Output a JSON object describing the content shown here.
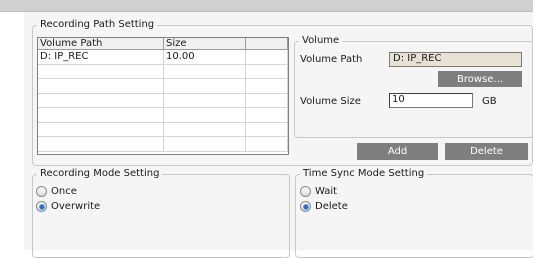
{
  "recording_path": {
    "legend": "Recording Path Setting",
    "columns": [
      "Volume Path",
      "Size",
      ""
    ],
    "rows": [
      [
        "D:  IP_REC",
        "10.00",
        ""
      ],
      [
        "",
        "",
        ""
      ],
      [
        "",
        "",
        ""
      ],
      [
        "",
        "",
        ""
      ],
      [
        "",
        "",
        ""
      ],
      [
        "",
        "",
        ""
      ],
      [
        "",
        "",
        ""
      ]
    ]
  },
  "volume": {
    "legend": "Volume",
    "path_label": "Volume Path",
    "path_value": "D:  IP_REC",
    "browse_label": "Browse...",
    "size_label": "Volume Size",
    "size_value": "10",
    "size_unit": "GB"
  },
  "actions": {
    "add_label": "Add",
    "delete_label": "Delete"
  },
  "recording_mode": {
    "legend": "Recording Mode Setting",
    "options": [
      {
        "label": "Once",
        "selected": false
      },
      {
        "label": "Overwrite",
        "selected": true
      }
    ]
  },
  "time_sync": {
    "legend": "Time Sync Mode Setting",
    "options": [
      {
        "label": "Wait",
        "selected": false
      },
      {
        "label": "Delete",
        "selected": true
      }
    ]
  },
  "colors": {
    "button_bg": "#7f7f7f",
    "readonly_bg": "#e6e3d5",
    "radio_accent": "#2a6fcf"
  }
}
